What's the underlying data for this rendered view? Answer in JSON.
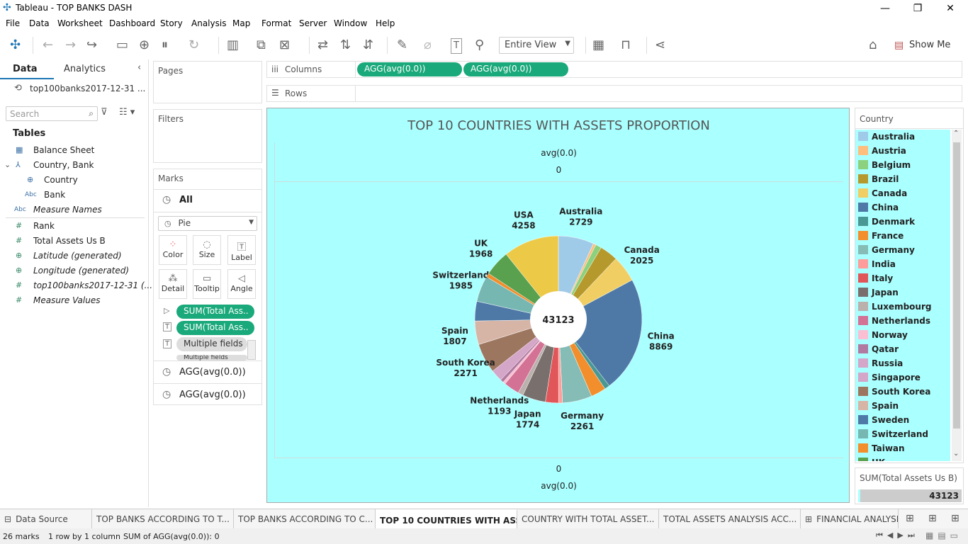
{
  "window": {
    "title": "Tableau - TOP BANKS DASH"
  },
  "menu": [
    "File",
    "Data",
    "Worksheet",
    "Dashboard",
    "Story",
    "Analysis",
    "Map",
    "Format",
    "Server",
    "Window",
    "Help"
  ],
  "toolbar": {
    "fit": "Entire View",
    "show_me": "Show Me"
  },
  "left": {
    "tab_data": "Data",
    "tab_analytics": "Analytics",
    "datasource": "top100banks2017-12-31 ...",
    "search_placeholder": "Search",
    "tables_heading": "Tables",
    "fields": [
      {
        "label": "Balance Sheet",
        "icon": "table-icon",
        "italic": false
      },
      {
        "label": "Country, Bank",
        "icon": "hierarchy-icon",
        "italic": false
      },
      {
        "label": "Country",
        "icon": "globe-icon",
        "italic": false
      },
      {
        "label": "Bank",
        "icon": "abc-icon",
        "italic": false
      },
      {
        "label": "Measure Names",
        "icon": "abc-icon",
        "italic": true
      },
      {
        "label": "Rank",
        "icon": "measure-icon",
        "italic": false
      },
      {
        "label": "Total Assets Us B",
        "icon": "measure-icon",
        "italic": false
      },
      {
        "label": "Latitude (generated)",
        "icon": "globe-icon",
        "italic": true
      },
      {
        "label": "Longitude (generated)",
        "icon": "globe-icon",
        "italic": true
      },
      {
        "label": "top100banks2017-12-31 (...",
        "icon": "measure-icon",
        "italic": true
      },
      {
        "label": "Measure Values",
        "icon": "measure-icon",
        "italic": true
      }
    ]
  },
  "shelves": {
    "pages": "Pages",
    "filters": "Filters",
    "marks": "Marks",
    "columns": "Columns",
    "rows": "Rows",
    "column_pills": [
      "AGG(avg(0.0))",
      "AGG(avg(0.0))"
    ],
    "marks_all": "All",
    "mark_type": "Pie",
    "mark_buttons": [
      "Color",
      "Size",
      "Label",
      "Detail",
      "Tooltip",
      "Angle"
    ],
    "mark_pills": [
      "SUM(Total Ass..",
      "SUM(Total Ass..",
      "Multiple fields",
      "Multiple fields"
    ],
    "agg_rows": [
      "AGG(avg(0.0))",
      "AGG(avg(0.0))"
    ]
  },
  "viz": {
    "title": "TOP 10 COUNTRIES WITH ASSETS PROPORTION",
    "top_header": "avg(0.0)",
    "top_value": "0",
    "bottom_value": "0",
    "bottom_header": "avg(0.0)",
    "center_total": "43123"
  },
  "chart_data": {
    "type": "pie",
    "title": "TOP 10 COUNTRIES WITH ASSETS PROPORTION",
    "total": 43123,
    "slices": [
      {
        "name": "Australia",
        "value": 2729,
        "color": "#a0cbe8",
        "label": true
      },
      {
        "name": "Austria",
        "value": 200,
        "color": "#ffbe7d",
        "label": false
      },
      {
        "name": "Belgium",
        "value": 450,
        "color": "#8cd17d",
        "label": false
      },
      {
        "name": "Brazil",
        "value": 1400,
        "color": "#b6992d",
        "label": false
      },
      {
        "name": "Canada",
        "value": 2025,
        "color": "#f1ce63",
        "label": true
      },
      {
        "name": "China",
        "value": 8869,
        "color": "#4e79a7",
        "label": true
      },
      {
        "name": "Denmark",
        "value": 400,
        "color": "#499894",
        "label": false
      },
      {
        "name": "France",
        "value": 1150,
        "color": "#f28e2b",
        "label": false
      },
      {
        "name": "Germany",
        "value": 2261,
        "color": "#86bcb6",
        "label": true
      },
      {
        "name": "India",
        "value": 300,
        "color": "#ff9d9a",
        "label": false
      },
      {
        "name": "Italy",
        "value": 1000,
        "color": "#e15759",
        "label": false
      },
      {
        "name": "Japan",
        "value": 1774,
        "color": "#79706e",
        "label": true
      },
      {
        "name": "Luxembourg",
        "value": 400,
        "color": "#bab0ac",
        "label": false
      },
      {
        "name": "Netherlands",
        "value": 1193,
        "color": "#d37295",
        "label": true
      },
      {
        "name": "Norway",
        "value": 200,
        "color": "#fabfd2",
        "label": false
      },
      {
        "name": "Qatar",
        "value": 250,
        "color": "#b07aa1",
        "label": false
      },
      {
        "name": "Russia",
        "value": 900,
        "color": "#d4a6c8",
        "label": false
      },
      {
        "name": "South Korea",
        "value": 2271,
        "color": "#9d7660",
        "label": true
      },
      {
        "name": "Spain",
        "value": 1807,
        "color": "#d7b5a6",
        "label": true
      },
      {
        "name": "Sweden",
        "value": 1500,
        "color": "#4e79a7",
        "label": false
      },
      {
        "name": "Switzerland",
        "value": 1985,
        "color": "#76b7b2",
        "label": true
      },
      {
        "name": "Taiwan",
        "value": 300,
        "color": "#f28e2b",
        "label": false
      },
      {
        "name": "UK",
        "value": 1968,
        "color": "#59a14f",
        "label": true
      },
      {
        "name": "USA",
        "value": 4258,
        "color": "#edc948",
        "label": true
      }
    ]
  },
  "legend": {
    "title": "Country",
    "items": [
      {
        "name": "Australia",
        "color": "#a0cbe8"
      },
      {
        "name": "Austria",
        "color": "#ffbe7d"
      },
      {
        "name": "Belgium",
        "color": "#8cd17d"
      },
      {
        "name": "Brazil",
        "color": "#b6992d"
      },
      {
        "name": "Canada",
        "color": "#f1ce63"
      },
      {
        "name": "China",
        "color": "#4e79a7"
      },
      {
        "name": "Denmark",
        "color": "#499894"
      },
      {
        "name": "France",
        "color": "#f28e2b"
      },
      {
        "name": "Germany",
        "color": "#86bcb6"
      },
      {
        "name": "India",
        "color": "#ff9d9a"
      },
      {
        "name": "Italy",
        "color": "#e15759"
      },
      {
        "name": "Japan",
        "color": "#79706e"
      },
      {
        "name": "Luxembourg",
        "color": "#bab0ac"
      },
      {
        "name": "Netherlands",
        "color": "#d37295"
      },
      {
        "name": "Norway",
        "color": "#fabfd2"
      },
      {
        "name": "Qatar",
        "color": "#b07aa1"
      },
      {
        "name": "Russia",
        "color": "#d4a6c8"
      },
      {
        "name": "Singapore",
        "color": "#d4a6c8"
      },
      {
        "name": "South Korea",
        "color": "#9d7660"
      },
      {
        "name": "Spain",
        "color": "#d7b5a6"
      },
      {
        "name": "Sweden",
        "color": "#4e79a7"
      },
      {
        "name": "Switzerland",
        "color": "#76b7b2"
      },
      {
        "name": "Taiwan",
        "color": "#f28e2b"
      },
      {
        "name": "UK",
        "color": "#59a14f"
      }
    ],
    "size_title": "SUM(Total Assets Us B)",
    "size_value": "43123"
  },
  "tabs": [
    "Data Source",
    "TOP BANKS ACCORDING TO T...",
    "TOP BANKS ACCORDING TO C...",
    "TOP 10 COUNTRIES WITH ASS...",
    "COUNTRY WITH TOTAL ASSET...",
    "TOTAL ASSETS ANALYSIS ACC...",
    "FINANCIAL ANALYSI"
  ],
  "status": {
    "marks": "26 marks",
    "rows": "1 row by 1 column",
    "sum": "SUM of AGG(avg(0.0)): 0"
  }
}
